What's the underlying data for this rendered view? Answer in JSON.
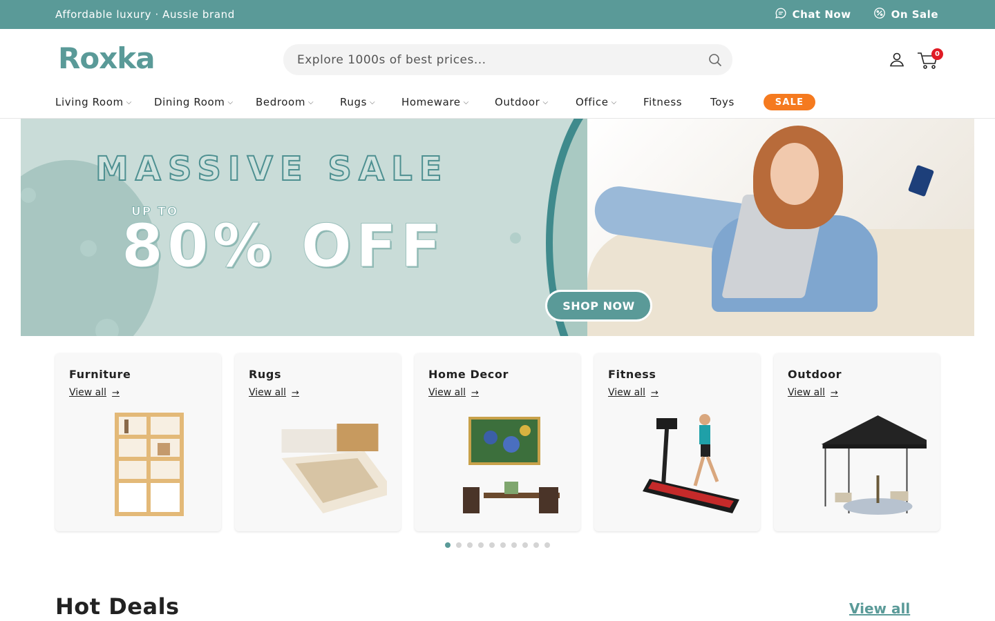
{
  "topbar": {
    "tagline": "Affordable luxury · Aussie brand",
    "chat_label": "Chat Now",
    "sale_label": "On Sale"
  },
  "header": {
    "logo": "Roxka",
    "search_placeholder": "Explore 1000s of best prices...",
    "cart_count": "0"
  },
  "nav": {
    "items": [
      {
        "label": "Living Room",
        "has_dropdown": true
      },
      {
        "label": "Dining Room",
        "has_dropdown": true
      },
      {
        "label": "Bedroom",
        "has_dropdown": true
      },
      {
        "label": "Rugs",
        "has_dropdown": true
      },
      {
        "label": "Homeware",
        "has_dropdown": true
      },
      {
        "label": "Outdoor",
        "has_dropdown": true
      },
      {
        "label": "Office",
        "has_dropdown": true
      },
      {
        "label": "Fitness",
        "has_dropdown": false
      },
      {
        "label": "Toys",
        "has_dropdown": false
      }
    ],
    "sale_label": "SALE"
  },
  "banner": {
    "headline": "MASSIVE SALE",
    "upto": "UP TO",
    "discount": "80% OFF",
    "cta": "SHOP NOW"
  },
  "categories": [
    {
      "title": "Furniture",
      "link": "View all"
    },
    {
      "title": "Rugs",
      "link": "View all"
    },
    {
      "title": "Home Decor",
      "link": "View all"
    },
    {
      "title": "Fitness",
      "link": "View all"
    },
    {
      "title": "Outdoor",
      "link": "View all"
    }
  ],
  "carousel": {
    "total_dots": 10,
    "active_index": 0
  },
  "hot_deals": {
    "title": "Hot Deals",
    "view_all": "View all"
  },
  "colors": {
    "brand": "#5a9a98",
    "sale": "#f57a1f",
    "badge": "#e01b24"
  }
}
